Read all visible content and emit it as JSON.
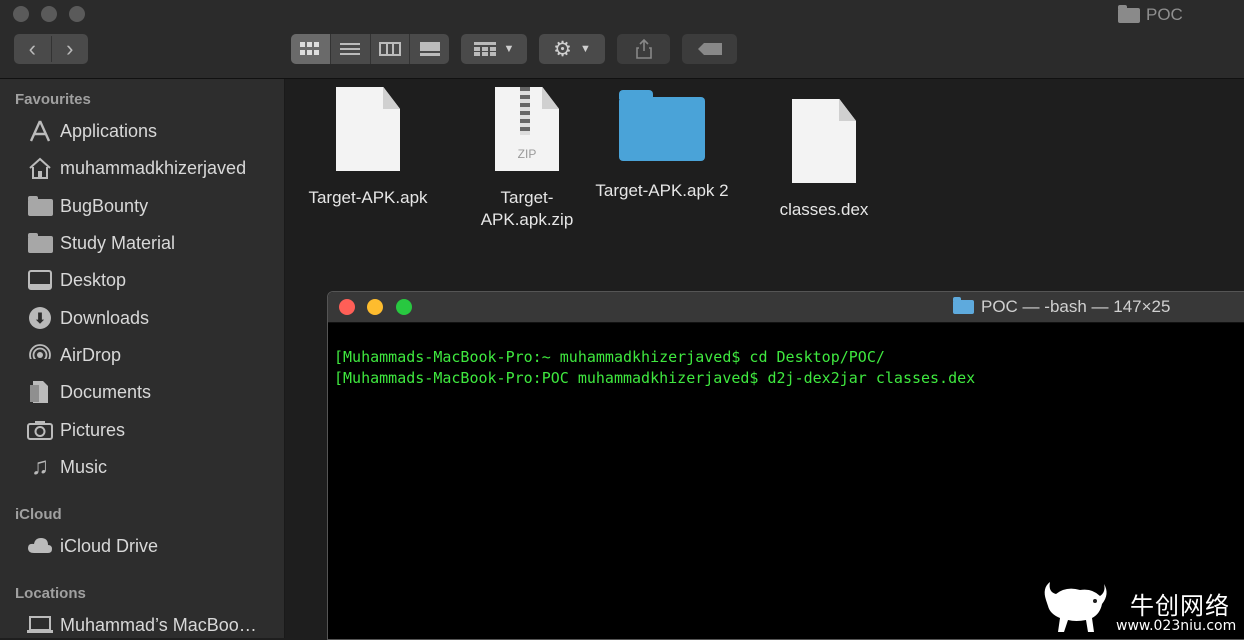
{
  "window": {
    "title": "POC"
  },
  "toolbar": {
    "back": "‹",
    "forward": "›"
  },
  "sidebar": {
    "favourites_header": "Favourites",
    "favourites": [
      {
        "label": "Applications",
        "icon": "applications-icon"
      },
      {
        "label": "muhammadkhizerjaved",
        "icon": "home-icon"
      },
      {
        "label": "BugBounty",
        "icon": "folder-icon"
      },
      {
        "label": "Study Material",
        "icon": "folder-icon"
      },
      {
        "label": "Desktop",
        "icon": "desktop-icon"
      },
      {
        "label": "Downloads",
        "icon": "downloads-icon"
      },
      {
        "label": "AirDrop",
        "icon": "airdrop-icon"
      },
      {
        "label": "Documents",
        "icon": "documents-icon"
      },
      {
        "label": "Pictures",
        "icon": "camera-icon"
      },
      {
        "label": "Music",
        "icon": "music-icon"
      }
    ],
    "icloud_header": "iCloud",
    "icloud": [
      {
        "label": "iCloud Drive",
        "icon": "cloud-icon"
      }
    ],
    "locations_header": "Locations",
    "locations": [
      {
        "label": "Muhammad’s MacBoo…",
        "icon": "laptop-icon"
      }
    ]
  },
  "files": [
    {
      "name": "Target-APK.apk",
      "type": "document"
    },
    {
      "name": "Target-APK.apk.zip",
      "type": "zip",
      "badge": "ZIP"
    },
    {
      "name": "Target-APK.apk 2",
      "type": "folder"
    },
    {
      "name": "classes.dex",
      "type": "document"
    }
  ],
  "terminal": {
    "title": "POC — -bash — 147×25",
    "lines": [
      "[Muhammads-MacBook-Pro:~ muhammadkhizerjaved$ cd Desktop/POC/",
      "[Muhammads-MacBook-Pro:POC muhammadkhizerjaved$ d2j-dex2jar classes.dex"
    ],
    "text_color": "#3fe83f"
  },
  "watermark": {
    "chinese": "牛创网络",
    "url": "www.023niu.com"
  }
}
